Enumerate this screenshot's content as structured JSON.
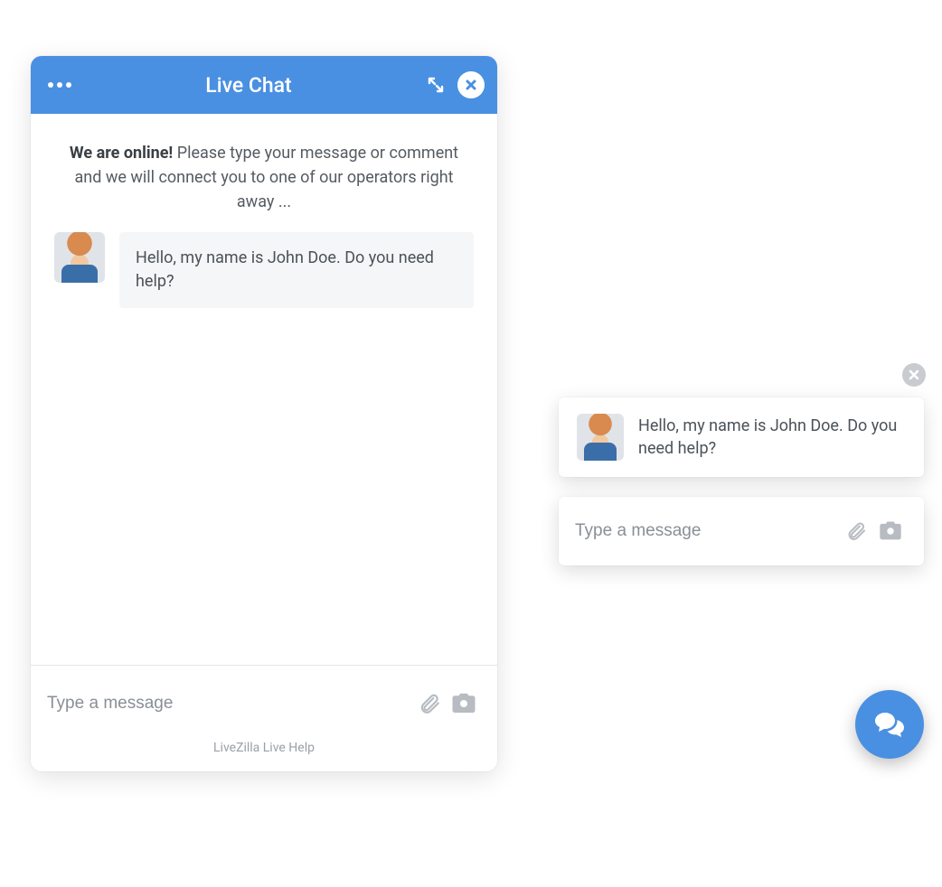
{
  "colors": {
    "accent": "#4a90e2",
    "icon_muted": "#b7bcc2"
  },
  "chat": {
    "header": {
      "title": "Live Chat"
    },
    "welcome": {
      "bold": "We are online!",
      "rest": " Please type your message or comment and we will connect you to one of our operators right away ..."
    },
    "message": {
      "avatar_alt": "operator-avatar",
      "text": "Hello, my name is John Doe. Do you need help?"
    },
    "input": {
      "placeholder": "Type a message"
    },
    "footer": "LiveZilla Live Help"
  },
  "mini": {
    "message": "Hello, my name is John Doe. Do you need help?",
    "input_placeholder": "Type a message"
  }
}
